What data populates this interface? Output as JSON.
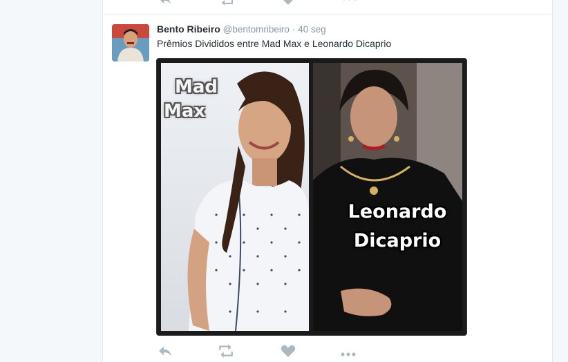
{
  "tweet": {
    "display_name": "Bento Ribeiro",
    "handle": "@bentomribeiro",
    "separator": "·",
    "time": "40 seg",
    "text": "Prêmios Divididos entre Mad Max e Leonardo Dicaprio"
  },
  "media": {
    "left_label_line1": "Mad",
    "left_label_line2": "Max",
    "right_label_line1": "Leonardo",
    "right_label_line2": "Dicaprio"
  },
  "actions": [
    "reply-icon",
    "retweet-icon",
    "like-icon",
    "more-icon"
  ],
  "colors": {
    "icon": "#aab8c2",
    "name": "#292f33",
    "meta": "#8899a6"
  }
}
